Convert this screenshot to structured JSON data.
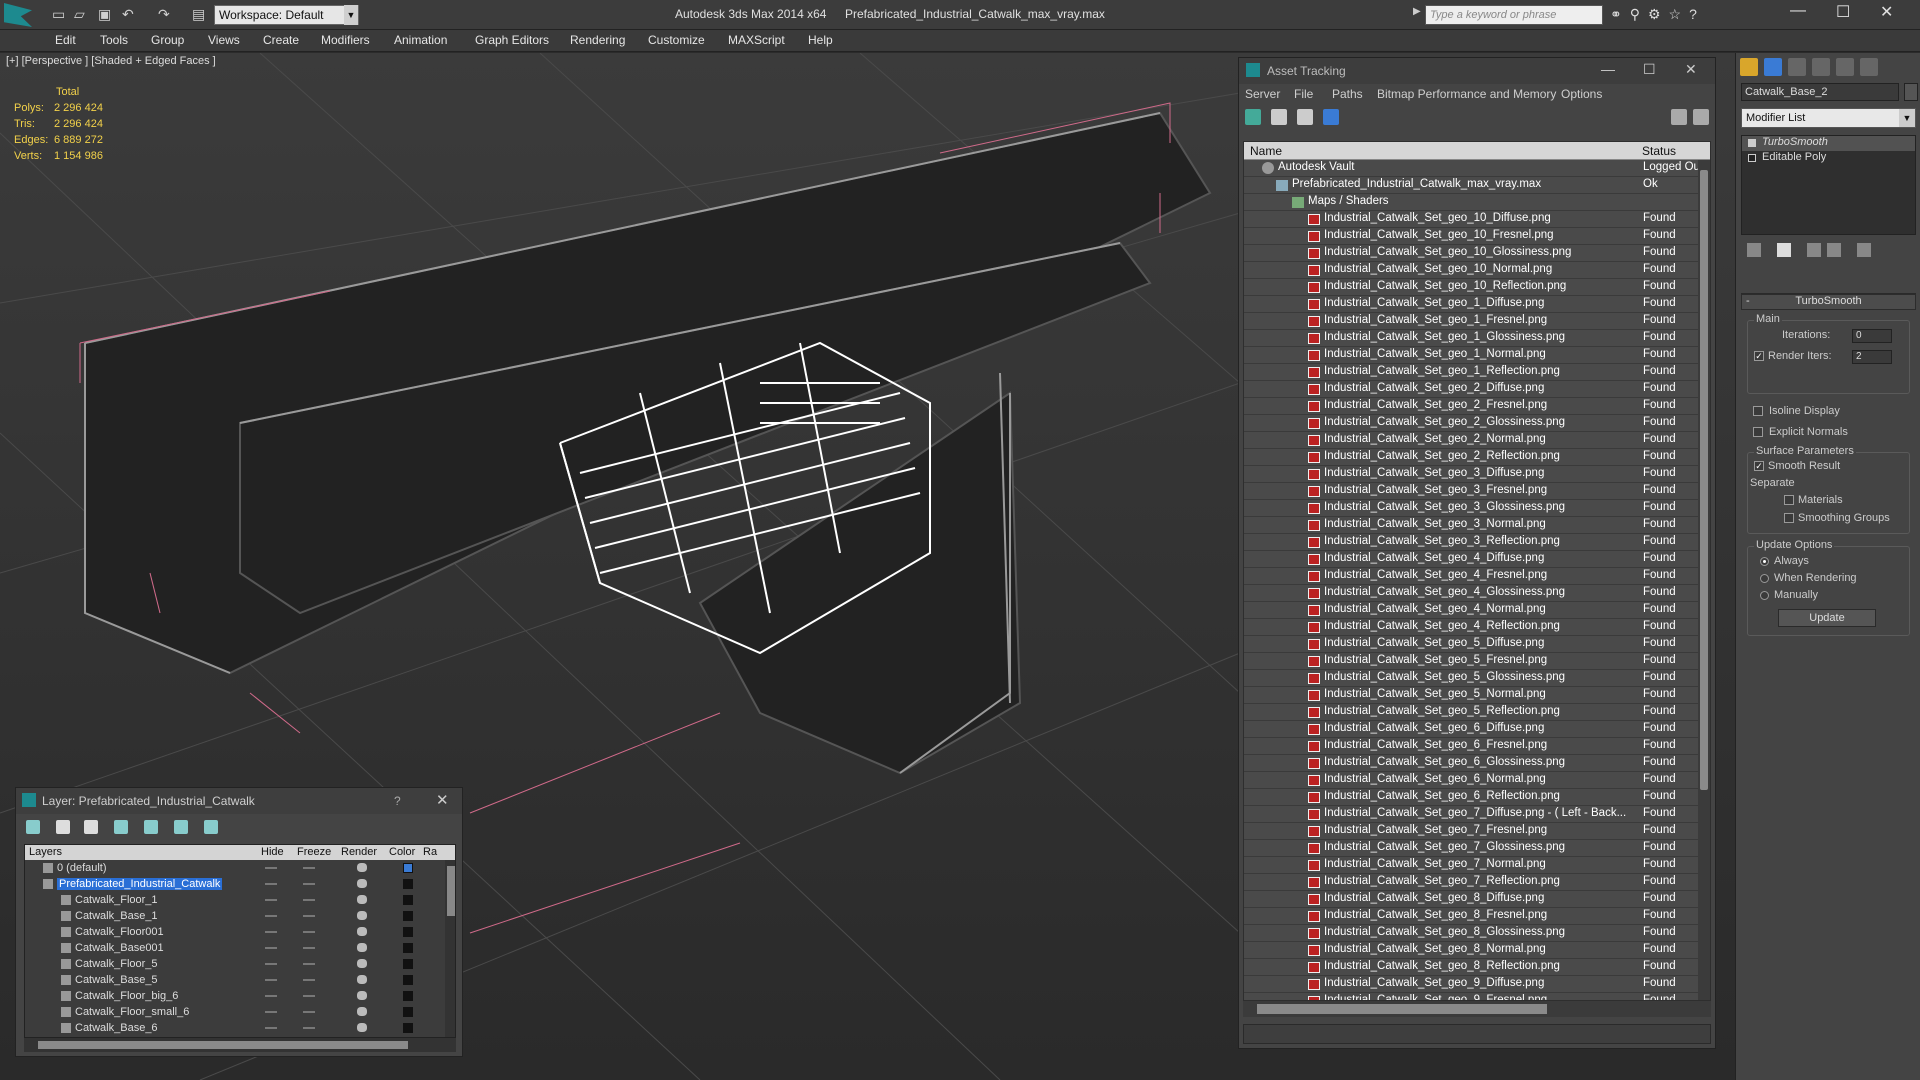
{
  "titlebar": {
    "workspace": "Workspace: Default",
    "app_title": "Autodesk 3ds Max 2014 x64",
    "file_title": "Prefabricated_Industrial_Catwalk_max_vray.max",
    "search_placeholder": "Type a keyword or phrase",
    "min": "—",
    "max": "☐",
    "close": "✕"
  },
  "menu": [
    "Edit",
    "Tools",
    "Group",
    "Views",
    "Create",
    "Modifiers",
    "Animation",
    "Graph Editors",
    "Rendering",
    "Customize",
    "MAXScript",
    "Help"
  ],
  "viewport": {
    "label": "[+] [Perspective ] [Shaded + Edged Faces ]",
    "stats_header": "Total",
    "stats": [
      {
        "label": "Polys:",
        "value": "2 296 424"
      },
      {
        "label": "Tris:",
        "value": "2 296 424"
      },
      {
        "label": "Edges:",
        "value": "6 889 272"
      },
      {
        "label": "Verts:",
        "value": "1 154 986"
      }
    ]
  },
  "asset_tracking": {
    "title": "Asset Tracking",
    "menu": [
      "Server",
      "File",
      "Paths",
      "Bitmap Performance and Memory",
      "Options"
    ],
    "col_name": "Name",
    "col_status": "Status",
    "vault": {
      "name": "Autodesk Vault",
      "status": "Logged Ou"
    },
    "maxfile": {
      "name": "Prefabricated_Industrial_Catwalk_max_vray.max",
      "status": "Ok"
    },
    "folder": "Maps / Shaders",
    "files": [
      "Industrial_Catwalk_Set_geo_10_Diffuse.png",
      "Industrial_Catwalk_Set_geo_10_Fresnel.png",
      "Industrial_Catwalk_Set_geo_10_Glossiness.png",
      "Industrial_Catwalk_Set_geo_10_Normal.png",
      "Industrial_Catwalk_Set_geo_10_Reflection.png",
      "Industrial_Catwalk_Set_geo_1_Diffuse.png",
      "Industrial_Catwalk_Set_geo_1_Fresnel.png",
      "Industrial_Catwalk_Set_geo_1_Glossiness.png",
      "Industrial_Catwalk_Set_geo_1_Normal.png",
      "Industrial_Catwalk_Set_geo_1_Reflection.png",
      "Industrial_Catwalk_Set_geo_2_Diffuse.png",
      "Industrial_Catwalk_Set_geo_2_Fresnel.png",
      "Industrial_Catwalk_Set_geo_2_Glossiness.png",
      "Industrial_Catwalk_Set_geo_2_Normal.png",
      "Industrial_Catwalk_Set_geo_2_Reflection.png",
      "Industrial_Catwalk_Set_geo_3_Diffuse.png",
      "Industrial_Catwalk_Set_geo_3_Fresnel.png",
      "Industrial_Catwalk_Set_geo_3_Glossiness.png",
      "Industrial_Catwalk_Set_geo_3_Normal.png",
      "Industrial_Catwalk_Set_geo_3_Reflection.png",
      "Industrial_Catwalk_Set_geo_4_Diffuse.png",
      "Industrial_Catwalk_Set_geo_4_Fresnel.png",
      "Industrial_Catwalk_Set_geo_4_Glossiness.png",
      "Industrial_Catwalk_Set_geo_4_Normal.png",
      "Industrial_Catwalk_Set_geo_4_Reflection.png",
      "Industrial_Catwalk_Set_geo_5_Diffuse.png",
      "Industrial_Catwalk_Set_geo_5_Fresnel.png",
      "Industrial_Catwalk_Set_geo_5_Glossiness.png",
      "Industrial_Catwalk_Set_geo_5_Normal.png",
      "Industrial_Catwalk_Set_geo_5_Reflection.png",
      "Industrial_Catwalk_Set_geo_6_Diffuse.png",
      "Industrial_Catwalk_Set_geo_6_Fresnel.png",
      "Industrial_Catwalk_Set_geo_6_Glossiness.png",
      "Industrial_Catwalk_Set_geo_6_Normal.png",
      "Industrial_Catwalk_Set_geo_6_Reflection.png",
      "Industrial_Catwalk_Set_geo_7_Diffuse.png - ( Left - Back...",
      "Industrial_Catwalk_Set_geo_7_Fresnel.png",
      "Industrial_Catwalk_Set_geo_7_Glossiness.png",
      "Industrial_Catwalk_Set_geo_7_Normal.png",
      "Industrial_Catwalk_Set_geo_7_Reflection.png",
      "Industrial_Catwalk_Set_geo_8_Diffuse.png",
      "Industrial_Catwalk_Set_geo_8_Fresnel.png",
      "Industrial_Catwalk_Set_geo_8_Glossiness.png",
      "Industrial_Catwalk_Set_geo_8_Normal.png",
      "Industrial_Catwalk_Set_geo_8_Reflection.png",
      "Industrial_Catwalk_Set_geo_9_Diffuse.png",
      "Industrial_Catwalk_Set_geo_9_Fresnel.png"
    ],
    "file_status": "Found"
  },
  "command_panel": {
    "object_name": "Catwalk_Base_2",
    "modifier_list": "Modifier List",
    "stack": [
      "TurboSmooth",
      "Editable Poly"
    ],
    "rollout_title": "TurboSmooth",
    "main_group": "Main",
    "iterations_label": "Iterations:",
    "iterations_value": "0",
    "render_iters_label": "Render Iters:",
    "render_iters_value": "2",
    "isoline": "Isoline Display",
    "explicit_normals": "Explicit Normals",
    "surface_group": "Surface Parameters",
    "smooth_result": "Smooth Result",
    "separate": "Separate",
    "materials": "Materials",
    "smoothing_groups": "Smoothing Groups",
    "update_group": "Update Options",
    "always": "Always",
    "when_rendering": "When Rendering",
    "manually": "Manually",
    "update_btn": "Update"
  },
  "layer_window": {
    "title": "Layer: Prefabricated_Industrial_Catwalk",
    "help": "?",
    "close": "✕",
    "cols": [
      "Layers",
      "Hide",
      "Freeze",
      "Render",
      "Color",
      "Ra"
    ],
    "rows": [
      {
        "name": "0 (default)",
        "indent": 1,
        "color": "#3a7bd5",
        "selected": false
      },
      {
        "name": "Prefabricated_Industrial_Catwalk",
        "indent": 1,
        "color": "#111111",
        "selected": true
      },
      {
        "name": "Catwalk_Floor_1",
        "indent": 2,
        "color": "#111111",
        "selected": false
      },
      {
        "name": "Catwalk_Base_1",
        "indent": 2,
        "color": "#111111",
        "selected": false
      },
      {
        "name": "Catwalk_Floor001",
        "indent": 2,
        "color": "#111111",
        "selected": false
      },
      {
        "name": "Catwalk_Base001",
        "indent": 2,
        "color": "#111111",
        "selected": false
      },
      {
        "name": "Catwalk_Floor_5",
        "indent": 2,
        "color": "#111111",
        "selected": false
      },
      {
        "name": "Catwalk_Base_5",
        "indent": 2,
        "color": "#111111",
        "selected": false
      },
      {
        "name": "Catwalk_Floor_big_6",
        "indent": 2,
        "color": "#111111",
        "selected": false
      },
      {
        "name": "Catwalk_Floor_small_6",
        "indent": 2,
        "color": "#111111",
        "selected": false
      },
      {
        "name": "Catwalk_Base_6",
        "indent": 2,
        "color": "#111111",
        "selected": false
      }
    ]
  }
}
